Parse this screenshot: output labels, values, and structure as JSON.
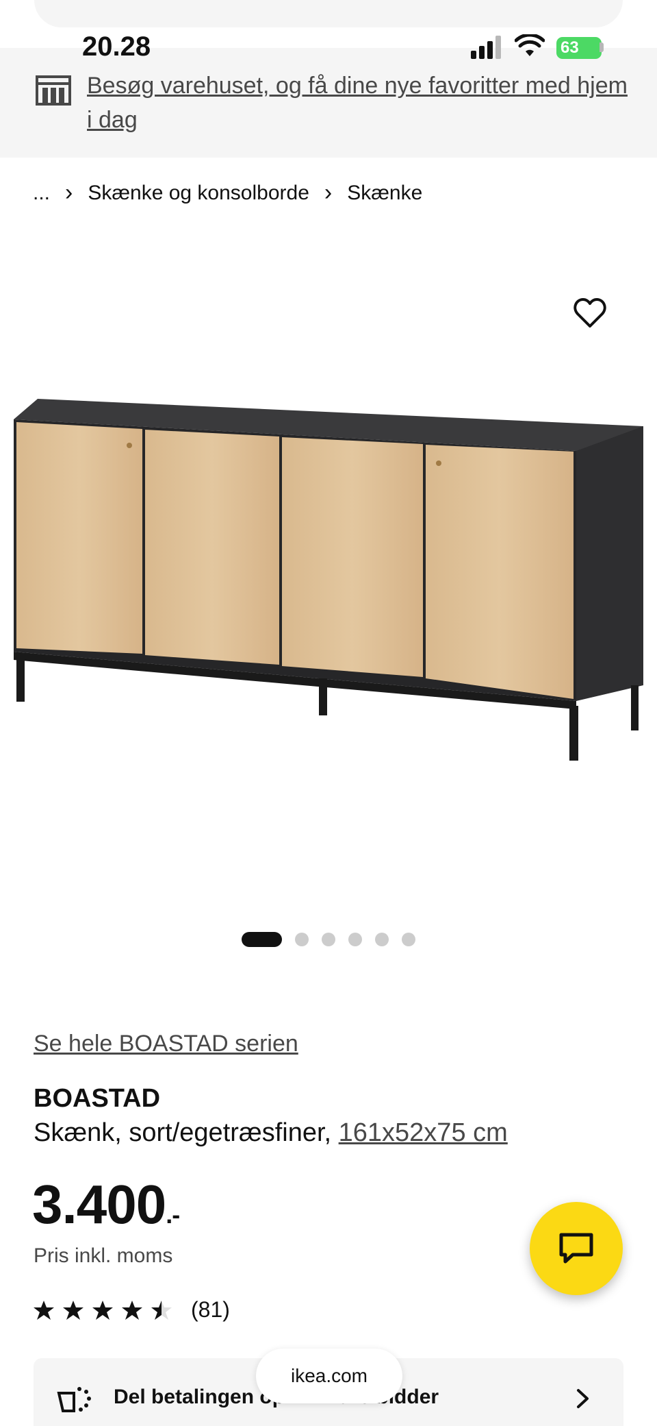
{
  "status_bar": {
    "time": "20.28",
    "battery": "63"
  },
  "store_banner": {
    "text": "Besøg varehuset, og få dine nye favoritter med hjem i dag"
  },
  "breadcrumb": {
    "ellipsis": "...",
    "items": [
      "Skænke og konsolborde",
      "Skænke"
    ]
  },
  "carousel": {
    "count": 6,
    "active_index": 0
  },
  "product": {
    "series_link": "Se hele BOASTAD serien",
    "name": "BOASTAD",
    "description": "Skænk, sort/egetræsfiner,",
    "dimensions": "161x52x75 cm",
    "price": "3.400",
    "price_suffix": ".-",
    "price_note": "Pris inkl. moms",
    "rating": 4.5,
    "review_count": "(81)"
  },
  "payment": {
    "text": "Del betalingen op i mindre bidder"
  },
  "browser": {
    "url": "ikea.com"
  },
  "colors": {
    "accent_yellow": "#fbd914",
    "banner_bg": "#f5f5f5",
    "battery_green": "#4cd964"
  },
  "icons": [
    "store-icon",
    "heart-icon",
    "star-icon",
    "chat-icon",
    "payment-icon",
    "chevron-right-icon"
  ]
}
